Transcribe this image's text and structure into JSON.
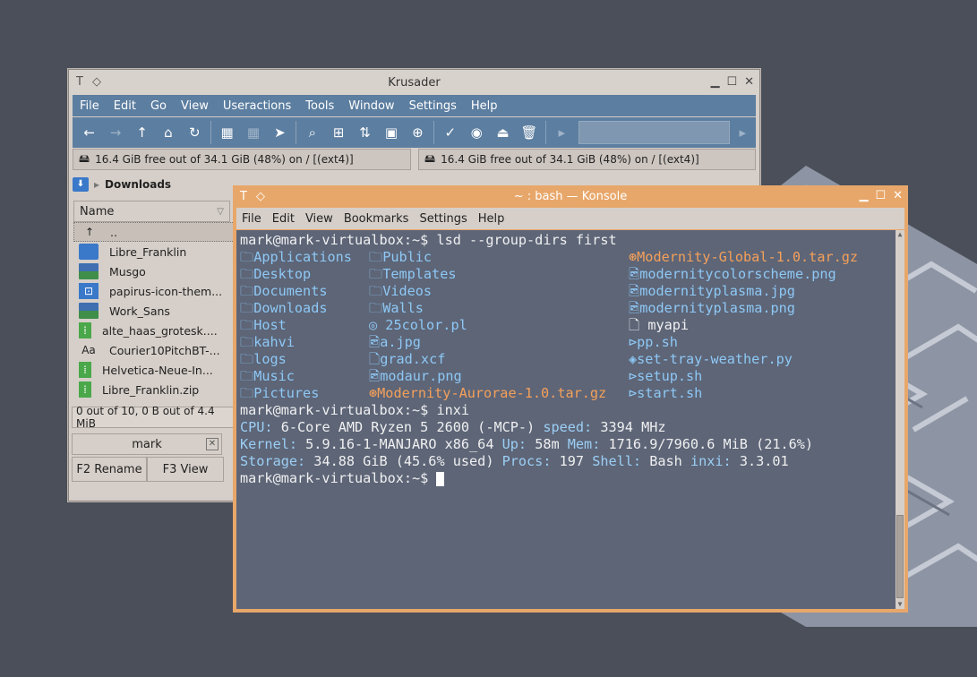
{
  "krusader": {
    "title": "Krusader",
    "menu": [
      "File",
      "Edit",
      "Go",
      "View",
      "Useractions",
      "Tools",
      "Window",
      "Settings",
      "Help"
    ],
    "left_panel_info": "16.4 GiB free out of 34.1 GiB (48%) on / [(ext4)]",
    "right_panel_info": "16.4 GiB free out of 34.1 GiB (48%) on / [(ext4)]",
    "current_dir": "Downloads",
    "column_name": "Name",
    "files": [
      {
        "name": "..",
        "icon": "up-arrow-icon"
      },
      {
        "name": "Libre_Franklin",
        "icon": "folder-icon"
      },
      {
        "name": "Musgo",
        "icon": "image-folder-icon"
      },
      {
        "name": "papirus-icon-them...",
        "icon": "folder-icon"
      },
      {
        "name": "Work_Sans",
        "icon": "folder-icon"
      },
      {
        "name": "alte_haas_grotesk....",
        "icon": "zip-icon"
      },
      {
        "name": "Courier10PitchBT-...",
        "icon": "font-icon"
      },
      {
        "name": "Helvetica-Neue-In...",
        "icon": "zip-icon"
      },
      {
        "name": "Libre_Franklin.zip",
        "icon": "zip-icon"
      }
    ],
    "status": "0 out of 10, 0 B out of 4.4 MiB",
    "cmdline_label": "mark",
    "fkeys": [
      "F2 Rename",
      "F3 View"
    ]
  },
  "konsole": {
    "title": "~ : bash — Konsole",
    "menu": [
      "File",
      "Edit",
      "View",
      "Bookmarks",
      "Settings",
      "Help"
    ],
    "prompt": "mark@mark-virtualbox:~$",
    "cmd1": " lsd --group-dirs first",
    "col1": [
      "Applications",
      "Desktop",
      "Documents",
      "Downloads",
      "Host",
      "kahvi",
      "logs",
      "Music",
      "Pictures"
    ],
    "col2": [
      {
        "text": "Public",
        "icon": "folder-icon",
        "cls": "blue"
      },
      {
        "text": "Templates",
        "icon": "folder-icon",
        "cls": "blue"
      },
      {
        "text": "Videos",
        "icon": "folder-icon",
        "cls": "blue"
      },
      {
        "text": "Walls",
        "icon": "folder-icon",
        "cls": "blue"
      },
      {
        "text": " 25color.pl",
        "icon": "perl-icon",
        "cls": "blue"
      },
      {
        "text": "a.jpg",
        "icon": "image-icon",
        "cls": "blue"
      },
      {
        "text": "grad.xcf",
        "icon": "file-icon",
        "cls": "blue"
      },
      {
        "text": "modaur.png",
        "icon": "image-icon",
        "cls": "blue"
      },
      {
        "text": "Modernity-Aurorae-1.0.tar.gz",
        "icon": "archive-icon",
        "cls": "orange"
      }
    ],
    "col3": [
      {
        "text": "Modernity-Global-1.0.tar.gz",
        "icon": "archive-icon",
        "cls": "orange"
      },
      {
        "text": "modernitycolorscheme.png",
        "icon": "image-icon",
        "cls": "blue"
      },
      {
        "text": "modernityplasma.jpg",
        "icon": "image-icon",
        "cls": "blue"
      },
      {
        "text": "modernityplasma.png",
        "icon": "image-icon",
        "cls": "blue"
      },
      {
        "text": " myapi",
        "icon": "file-icon",
        "cls": "white"
      },
      {
        "text": "pp.sh",
        "icon": "shell-icon",
        "cls": "blue"
      },
      {
        "text": "set-tray-weather.py",
        "icon": "python-icon",
        "cls": "blue"
      },
      {
        "text": "setup.sh",
        "icon": "shell-icon",
        "cls": "blue"
      },
      {
        "text": "start.sh",
        "icon": "shell-icon",
        "cls": "blue"
      }
    ],
    "cmd2": " inxi",
    "inxi": {
      "cpu_label": "CPU:",
      "cpu": " 6-Core AMD Ryzen 5 2600 (-MCP-) ",
      "speed_label": "speed:",
      "speed": " 3394 MHz",
      "kernel_label": "Kernel:",
      "kernel": " 5.9.16-1-MANJARO x86_64 ",
      "up_label": "Up:",
      "up": " 58m ",
      "mem_label": "Mem:",
      "mem": " 1716.9/7960.6 MiB (21.6%)",
      "storage_label": "Storage:",
      "storage": " 34.88 GiB (45.6% used) ",
      "procs_label": "Procs:",
      "procs": " 197 ",
      "shell_label": "Shell:",
      "shell": " Bash ",
      "inxi_label": "inxi:",
      "inxi_ver": " 3.3.01"
    }
  }
}
